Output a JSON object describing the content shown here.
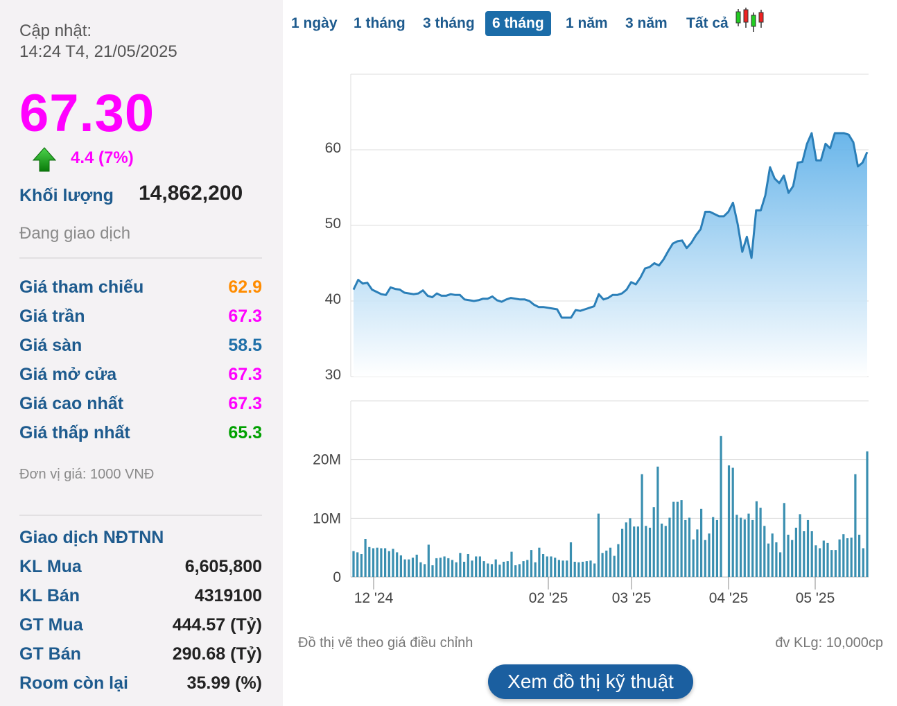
{
  "update": {
    "label": "Cập nhật:",
    "time": "14:24 T4, 21/05/2025"
  },
  "quote": {
    "price": "67.30",
    "change": "4.4 (7%)",
    "volume_label": "Khối lượng",
    "volume": "14,862,200",
    "status": "Đang giao dịch"
  },
  "price_rows": [
    {
      "label": "Giá tham chiếu",
      "value": "62.9",
      "color": "#ff8c00"
    },
    {
      "label": "Giá trần",
      "value": "67.3",
      "color": "#ff00ff"
    },
    {
      "label": "Giá sàn",
      "value": "58.5",
      "color": "#1e6fa8"
    },
    {
      "label": "Giá mở cửa",
      "value": "67.3",
      "color": "#ff00ff"
    },
    {
      "label": "Giá cao nhất",
      "value": "67.3",
      "color": "#ff00ff"
    },
    {
      "label": "Giá thấp nhất",
      "value": "65.3",
      "color": "#00a000"
    }
  ],
  "unit_note": "Đơn vị giá: 1000 VNĐ",
  "foreign": {
    "title": "Giao dịch NĐTNN",
    "rows": [
      {
        "label": "KL Mua",
        "value": "6,605,800"
      },
      {
        "label": "KL Bán",
        "value": "4319100"
      },
      {
        "label": "GT Mua",
        "value": "444.57 (Tỷ)"
      },
      {
        "label": "GT Bán",
        "value": "290.68 (Tỷ)"
      },
      {
        "label": "Room còn lại",
        "value": "35.99 (%)"
      }
    ]
  },
  "tabs": [
    "1 ngày",
    "1 tháng",
    "3 tháng",
    "6 tháng",
    "1 năm",
    "3 năm",
    "Tất cả"
  ],
  "active_tab": "6 tháng",
  "chart_icon": "candlestick-icon",
  "chart_data": [
    {
      "type": "area",
      "series": [
        {
          "values": [
            41.5,
            42.8,
            42.3,
            42.4,
            41.5,
            41.2,
            40.9,
            40.8,
            41.8,
            41.6,
            41.5,
            41.1,
            41.0,
            40.9,
            41.0,
            41.4,
            40.7,
            40.5,
            41.0,
            40.7,
            40.7,
            40.9,
            40.8,
            40.8,
            40.2,
            40.1,
            40.0,
            40.1,
            40.3,
            40.3,
            40.6,
            40.1,
            39.9,
            40.2,
            40.4,
            40.3,
            40.2,
            40.2,
            40.0,
            39.5,
            39.2,
            39.2,
            39.1,
            39.0,
            38.9,
            37.8,
            37.8,
            37.8,
            38.8,
            38.7,
            38.9,
            39.1,
            39.3,
            40.9,
            40.2,
            40.4,
            40.8,
            40.8,
            41.0,
            41.5,
            42.5,
            42.2,
            43.1,
            44.3,
            44.5,
            45.0,
            44.7,
            45.5,
            46.6,
            47.6,
            47.9,
            48.0,
            47.0,
            47.7,
            48.7,
            49.5,
            51.8,
            51.8,
            51.5,
            51.2,
            51.2,
            51.8,
            53.0,
            50.2,
            46.5,
            48.5,
            45.7,
            52.0,
            52.0,
            54.0,
            57.7,
            56.2,
            55.6,
            56.6,
            54.3,
            55.2,
            58.3,
            58.4,
            60.8,
            62.2,
            58.6,
            58.6,
            60.8,
            60.2,
            62.2,
            62.2,
            62.2,
            62.0,
            61.0,
            57.8,
            58.3,
            59.7
          ]
        }
      ],
      "x_ticks": [
        "12 '24",
        "02 '25",
        "03 '25",
        "04 '25",
        "05 '25"
      ],
      "y_ticks": [
        "30",
        "40",
        "50",
        "60"
      ],
      "ylim": [
        30,
        70
      ]
    },
    {
      "type": "bar",
      "series": [
        {
          "values": [
            4.4,
            4.2,
            3.9,
            6.5,
            5.1,
            4.9,
            5.0,
            4.9,
            4.9,
            4.4,
            4.8,
            4.2,
            3.7,
            3.0,
            3.0,
            3.3,
            3.8,
            2.5,
            2.2,
            5.5,
            2.0,
            3.2,
            3.3,
            3.5,
            3.2,
            2.9,
            2.5,
            4.1,
            2.6,
            3.9,
            2.8,
            3.5,
            3.5,
            2.7,
            2.3,
            2.2,
            3.0,
            2.1,
            2.6,
            2.7,
            4.3,
            2.0,
            2.2,
            2.7,
            2.9,
            4.6,
            2.5,
            5.0,
            3.9,
            3.5,
            3.5,
            3.3,
            2.9,
            2.8,
            2.8,
            5.9,
            2.6,
            2.5,
            2.6,
            2.7,
            2.8,
            2.3,
            10.8,
            4.1,
            4.5,
            5.0,
            3.6,
            5.6,
            8.2,
            9.3,
            10.0,
            8.6,
            8.6,
            17.5,
            8.7,
            8.4,
            11.9,
            18.8,
            9.1,
            8.7,
            10.1,
            12.8,
            12.8,
            13.1,
            9.7,
            10.1,
            6.4,
            8.1,
            11.6,
            6.3,
            7.4,
            10.2,
            9.7,
            24.0,
            0,
            19.0,
            18.6,
            10.6,
            10.1,
            9.8,
            10.8,
            9.7,
            12.9,
            11.8,
            8.7,
            5.7,
            7.4,
            5.9,
            4.2,
            12.6,
            7.2,
            6.3,
            8.4,
            10.7,
            7.8,
            9.7,
            7.8,
            5.4,
            4.9,
            6.2,
            5.8,
            4.6,
            4.6,
            6.4,
            7.3,
            6.6,
            6.7,
            17.5,
            7.2,
            4.9,
            21.4
          ]
        }
      ],
      "x_ticks": [
        "12 '24",
        "02 '25",
        "03 '25",
        "04 '25",
        "05 '25"
      ],
      "y_ticks": [
        "0",
        "10M",
        "20M"
      ],
      "ylim": [
        0,
        30
      ]
    }
  ],
  "notes": {
    "left": "Đồ thị vẽ theo giá điều chỉnh",
    "right": "đv KLg: 10,000cp"
  },
  "tech_button": "Xem đồ thị kỹ thuật"
}
